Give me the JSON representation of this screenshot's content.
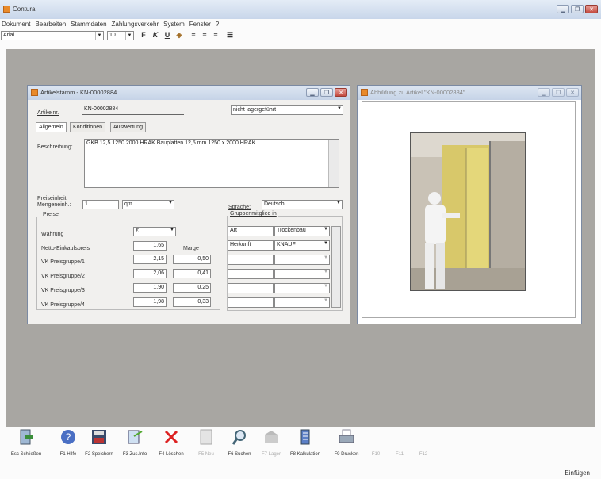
{
  "app": {
    "title": "Contura"
  },
  "menu": [
    "Dokument",
    "Bearbeiten",
    "Stammdaten",
    "Zahlungsverkehr",
    "System",
    "Fenster",
    "?"
  ],
  "format": {
    "font": "Arial",
    "size": "10",
    "bold": "F",
    "italic": "K",
    "underline": "U"
  },
  "article_window": {
    "title": "Artikelstamm - KN-00002884",
    "artikelnr_label": "Artikelnr.",
    "artikelnr": "KN-00002884",
    "storage": "nicht lagergeführt",
    "tabs": [
      "Allgemein",
      "Konditionen",
      "Auswertung"
    ],
    "beschreibung_label": "Beschreibung:",
    "beschreibung": "GKB 12,5 1250 2000 HRAK Bauplatten 12,5 mm 1250 x 2000 HRAK",
    "preiseinheit_label": "Preiseinheit",
    "mengeneinh_label": "Mengeneinh.:",
    "preiseinheit": "1",
    "mengeneinh": "qm",
    "preise_label": "Preise",
    "waehrung_label": "Währung",
    "waehrung": "€",
    "netto_label": "Netto-Einkaufspreis",
    "netto": "1,65",
    "marge_label": "Marge",
    "groups": [
      {
        "label": "VK Preisgruppe/1",
        "price": "2,15",
        "marge": "0,50"
      },
      {
        "label": "VK Preisgruppe/2",
        "price": "2,06",
        "marge": "0,41"
      },
      {
        "label": "VK Preisgruppe/3",
        "price": "1,90",
        "marge": "0,25"
      },
      {
        "label": "VK Preisgruppe/4",
        "price": "1,98",
        "marge": "0,33"
      }
    ],
    "sprache_label": "Sprache:",
    "sprache": "Deutsch",
    "gruppen_label": "Gruppenmitglied in",
    "gruppen": [
      {
        "k": "Art",
        "v": "Trockenbau"
      },
      {
        "k": "Herkunft",
        "v": "KNAUF"
      }
    ]
  },
  "image_window": {
    "title": "Abbildung zu Artikel \"KN-00002884\""
  },
  "fkeys": [
    {
      "label": "Esc Schließen",
      "icon": "exit-icon",
      "enabled": true
    },
    {
      "label": "F1 Hilfe",
      "icon": "help-icon",
      "enabled": true
    },
    {
      "label": "F2 Speichern",
      "icon": "save-icon",
      "enabled": true
    },
    {
      "label": "F3 Zus.Info",
      "icon": "info-icon",
      "enabled": true
    },
    {
      "label": "F4 Löschen",
      "icon": "delete-icon",
      "enabled": true
    },
    {
      "label": "F5 Neu",
      "icon": "new-icon",
      "enabled": false
    },
    {
      "label": "F6 Suchen",
      "icon": "search-icon",
      "enabled": true
    },
    {
      "label": "F7 Lager",
      "icon": "stock-icon",
      "enabled": false
    },
    {
      "label": "F8 Kalkulation",
      "icon": "calc-icon",
      "enabled": true
    },
    {
      "label": "F9 Drucken",
      "icon": "print-icon",
      "enabled": true
    },
    {
      "label": "F10",
      "icon": "",
      "enabled": false
    },
    {
      "label": "F11",
      "icon": "",
      "enabled": false
    },
    {
      "label": "F12",
      "icon": "",
      "enabled": false
    }
  ],
  "status": {
    "mode": "Einfügen"
  }
}
